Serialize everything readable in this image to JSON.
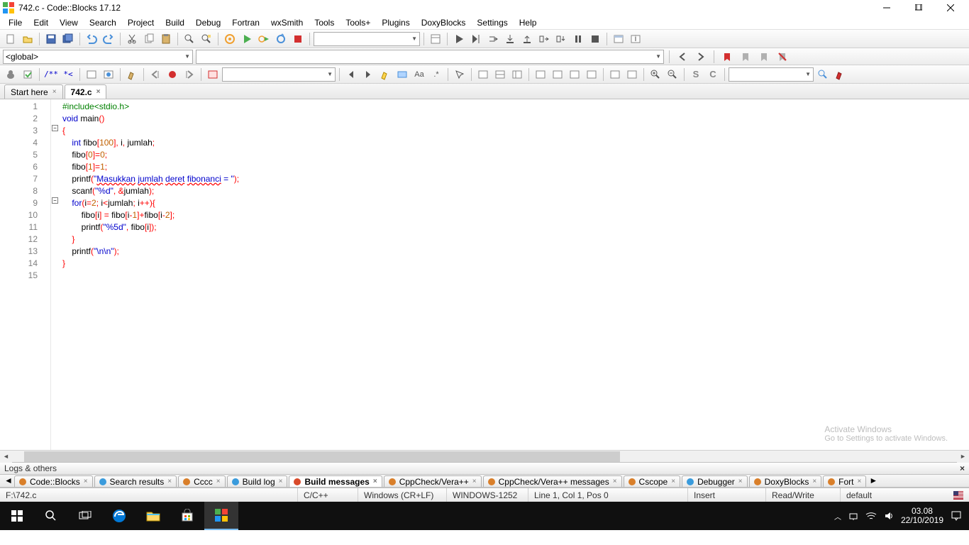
{
  "window": {
    "title": "742.c - Code::Blocks 17.12"
  },
  "menu": [
    "File",
    "Edit",
    "View",
    "Search",
    "Project",
    "Build",
    "Debug",
    "Fortran",
    "wxSmith",
    "Tools",
    "Tools+",
    "Plugins",
    "DoxyBlocks",
    "Settings",
    "Help"
  ],
  "scope": {
    "value": "<global>"
  },
  "tabs": [
    {
      "label": "Start here",
      "active": false
    },
    {
      "label": "742.c",
      "active": true
    }
  ],
  "code": {
    "lines": [
      {
        "n": 1,
        "html": "<span class='pp'>#include&lt;stdio.h&gt;</span>"
      },
      {
        "n": 2,
        "html": "<span class='kw'>void</span> main<span class='op'>()</span>"
      },
      {
        "n": 3,
        "html": "<span class='op'>{</span>"
      },
      {
        "n": 4,
        "html": "    <span class='kw'>int</span> fibo<span class='op'>[</span><span class='num'>100</span><span class='op'>],</span> i<span class='op'>,</span> jumlah<span class='op'>;</span>"
      },
      {
        "n": 5,
        "html": "    fibo<span class='op'>[</span><span class='num'>0</span><span class='op'>]=</span><span class='num'>0</span><span class='op'>;</span>"
      },
      {
        "n": 6,
        "html": "    fibo<span class='op'>[</span><span class='num'>1</span><span class='op'>]=</span><span class='num'>1</span><span class='op'>;</span>"
      },
      {
        "n": 7,
        "html": "    printf<span class='op'>(</span><span class='str'>\"<span class='spell'>Masukkan</span> <span class='spell'>jumlah</span> <span class='spell'>deret</span> <span class='spell'>fibonanci</span> = \"</span><span class='op'>);</span>"
      },
      {
        "n": 8,
        "html": "    scanf<span class='op'>(</span><span class='str'>\"%d\"</span><span class='op'>, &amp;</span>jumlah<span class='op'>);</span>"
      },
      {
        "n": 9,
        "html": "    <span class='kw'>for</span><span class='op'>(</span>i<span class='op'>=</span><span class='num'>2</span><span class='op'>;</span> i<span class='op'>&lt;</span>jumlah<span class='op'>;</span> i<span class='op'>++){</span>"
      },
      {
        "n": 10,
        "html": "        fibo<span class='op'>[</span>i<span class='op'>] =</span> fibo<span class='op'>[</span>i<span class='op'>-</span><span class='num'>1</span><span class='op'>]+</span>fibo<span class='op'>[</span>i<span class='op'>-</span><span class='num'>2</span><span class='op'>];</span>"
      },
      {
        "n": 11,
        "html": "        printf<span class='op'>(</span><span class='str'>\"%5d\"</span><span class='op'>,</span> fibo<span class='op'>[</span>i<span class='op'>]);</span>"
      },
      {
        "n": 12,
        "html": "    <span class='op'>}</span>"
      },
      {
        "n": 13,
        "html": "    printf<span class='op'>(</span><span class='str'>\"\\n\\n\"</span><span class='op'>);</span>"
      },
      {
        "n": 14,
        "html": "<span class='op'>}</span>"
      },
      {
        "n": 15,
        "html": ""
      }
    ]
  },
  "logs": {
    "header": "Logs & others",
    "tabs": [
      {
        "label": "Code::Blocks",
        "color": "#d97f2a",
        "active": false
      },
      {
        "label": "Search results",
        "color": "#3a9bdc",
        "active": false
      },
      {
        "label": "Cccc",
        "color": "#d97f2a",
        "active": false
      },
      {
        "label": "Build log",
        "color": "#3a9bdc",
        "active": false
      },
      {
        "label": "Build messages",
        "color": "#d94a2a",
        "active": true
      },
      {
        "label": "CppCheck/Vera++",
        "color": "#d97f2a",
        "active": false
      },
      {
        "label": "CppCheck/Vera++ messages",
        "color": "#d97f2a",
        "active": false
      },
      {
        "label": "Cscope",
        "color": "#d97f2a",
        "active": false
      },
      {
        "label": "Debugger",
        "color": "#3a9bdc",
        "active": false
      },
      {
        "label": "DoxyBlocks",
        "color": "#d97f2a",
        "active": false
      },
      {
        "label": "Fort",
        "color": "#d97f2a",
        "active": false
      }
    ]
  },
  "status": {
    "path": "F:\\742.c",
    "lang": "C/C++",
    "eol": "Windows (CR+LF)",
    "encoding": "WINDOWS-1252",
    "pos": "Line 1, Col 1, Pos 0",
    "insert": "Insert",
    "rw": "Read/Write",
    "profile": "default"
  },
  "watermark": {
    "title": "Activate Windows",
    "sub": "Go to Settings to activate Windows."
  },
  "tray": {
    "time": "03.08",
    "date": "22/10/2019"
  }
}
